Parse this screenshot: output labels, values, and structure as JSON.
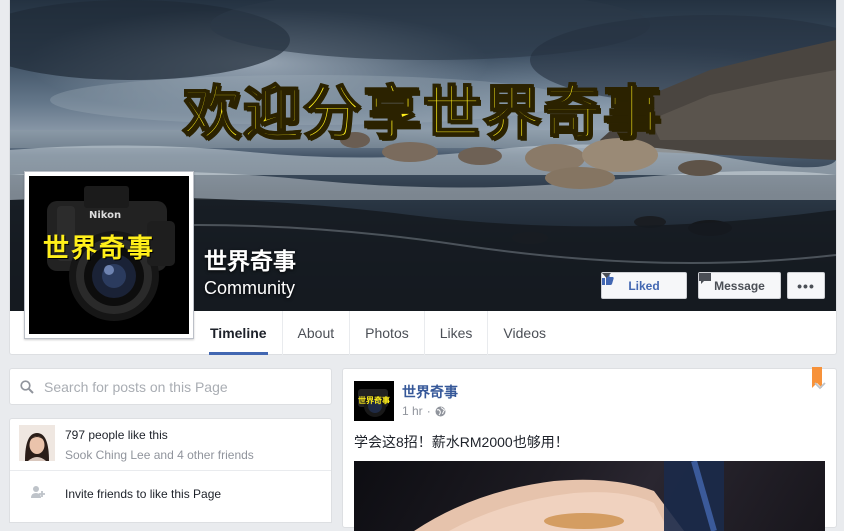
{
  "cover": {
    "banner_text": "欢迎分享世界奇事",
    "page_name": "世界奇事",
    "category": "Community"
  },
  "profile": {
    "logo_text": "世界奇事",
    "camera_brand": "Nikon"
  },
  "actions": {
    "liked_label": "Liked",
    "message_label": "Message",
    "more_label": "•••"
  },
  "tabs": [
    {
      "label": "Timeline",
      "active": true
    },
    {
      "label": "About"
    },
    {
      "label": "Photos"
    },
    {
      "label": "Likes"
    },
    {
      "label": "Videos"
    }
  ],
  "search": {
    "placeholder": "Search for posts on this Page"
  },
  "likes": {
    "count_text": "797 people like this",
    "friends_text": "Sook Ching Lee and 4 other friends",
    "invite_text": "Invite friends to like this Page"
  },
  "post": {
    "author": "世界奇事",
    "time": "1 hr",
    "separator": "·",
    "text": "学会这8招！薪水RM2000也够用！"
  },
  "colors": {
    "fb_blue": "#4267b2",
    "link_blue": "#365899",
    "bookmark_orange": "#f7923a",
    "banner_yellow": "#ffef1a"
  }
}
